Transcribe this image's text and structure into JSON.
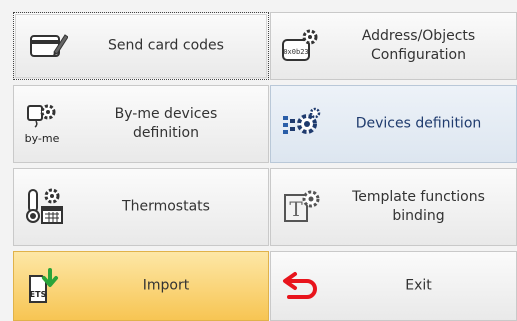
{
  "buttons": {
    "send_card_codes": {
      "label": "Send card codes",
      "icon": "card-pencil-icon"
    },
    "address_objects_configuration": {
      "label": "Address/Objects\nConfiguration",
      "icon": "address-gear-icon"
    },
    "byme_devices_definition": {
      "label": "By-me devices\ndefinition",
      "icon": "byme-gear-icon",
      "icon_text": "by-me"
    },
    "devices_definition": {
      "label": "Devices definition",
      "icon": "devices-gear-icon"
    },
    "thermostats": {
      "label": "Thermostats",
      "icon": "thermometer-calendar-icon"
    },
    "template_functions_binding": {
      "label": "Template functions\nbinding",
      "icon": "template-gear-icon"
    },
    "import": {
      "label": "Import",
      "icon": "ets-import-icon",
      "icon_text": "ETS"
    },
    "exit": {
      "label": "Exit",
      "icon": "exit-arrow-icon"
    }
  },
  "colors": {
    "selected_bg": "#dde6f0",
    "import_bg": "#f7c553",
    "exit_arrow": "#e8141c",
    "import_arrow": "#2aa43a"
  }
}
